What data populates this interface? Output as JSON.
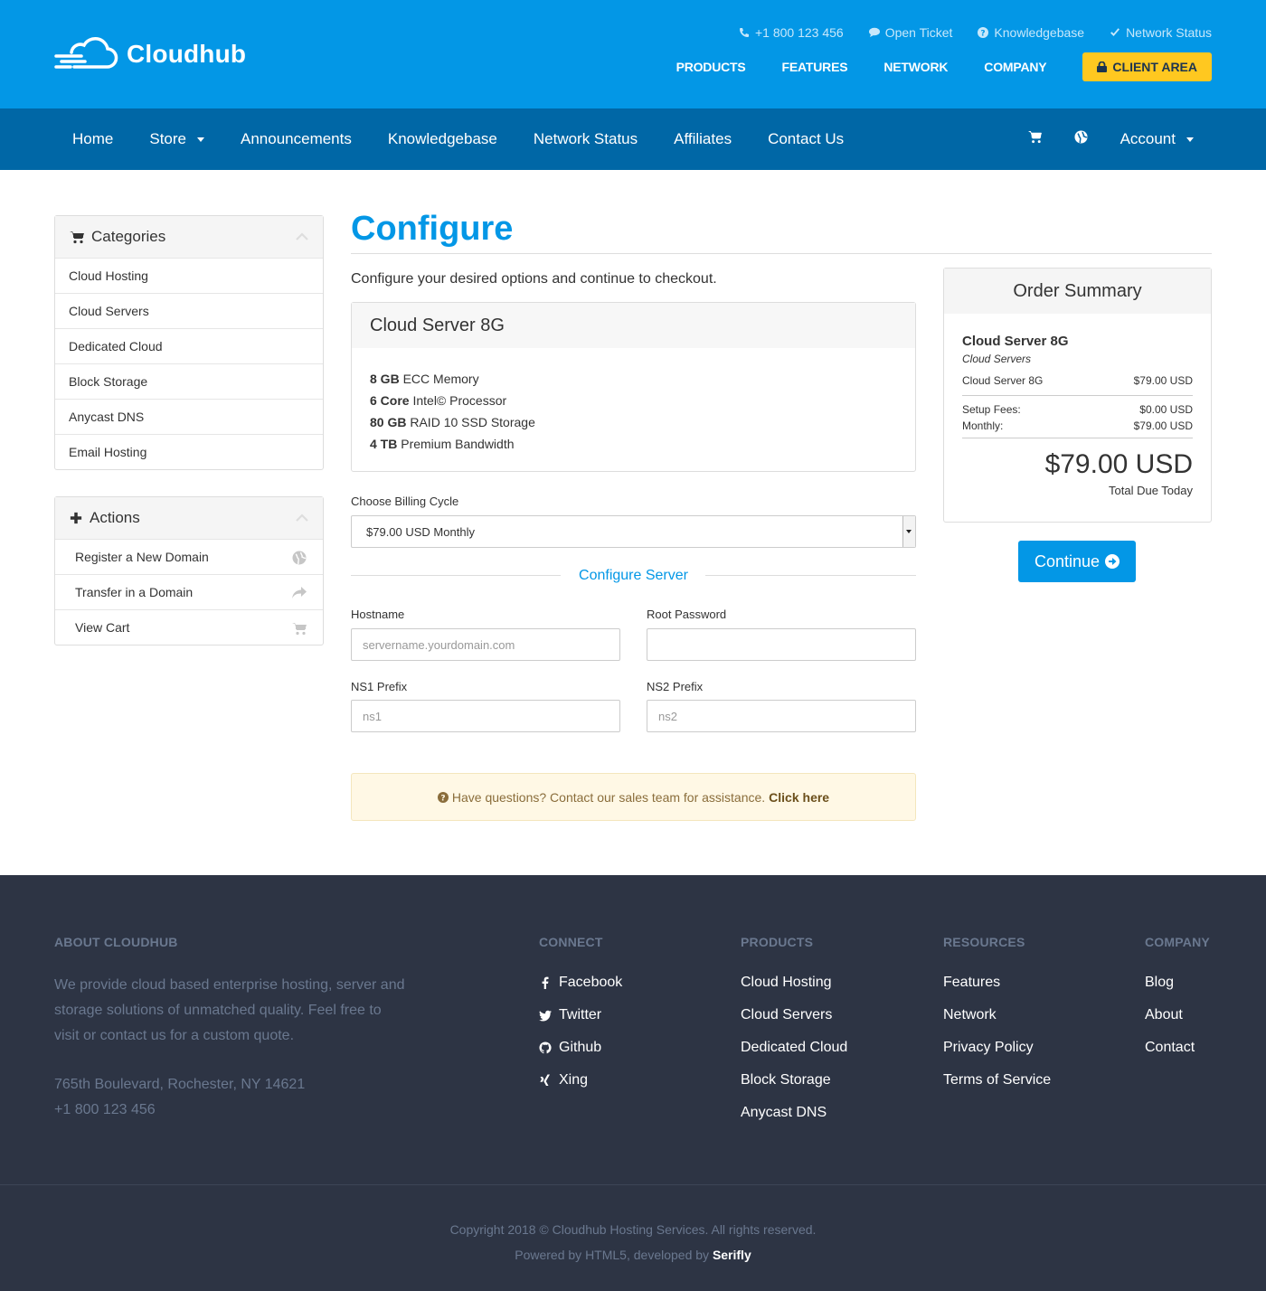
{
  "header": {
    "logo_text": "Cloudhub",
    "utility": [
      {
        "icon": "phone-icon",
        "label": "+1 800 123 456"
      },
      {
        "icon": "chat-icon",
        "label": "Open Ticket"
      },
      {
        "icon": "question-icon",
        "label": "Knowledgebase"
      },
      {
        "icon": "check-icon",
        "label": "Network Status"
      }
    ],
    "nav": [
      "PRODUCTS",
      "FEATURES",
      "NETWORK",
      "COMPANY"
    ],
    "client_area": "CLIENT AREA",
    "colors": {
      "primary": "#0397e6",
      "subnav": "#0067a6",
      "accent": "#ffc820",
      "footer": "#2d3444"
    }
  },
  "subnav": {
    "items": [
      "Home",
      "Store",
      "Announcements",
      "Knowledgebase",
      "Network Status",
      "Affiliates",
      "Contact Us"
    ],
    "account": "Account"
  },
  "sidebar": {
    "categories": {
      "title": "Categories",
      "items": [
        "Cloud Hosting",
        "Cloud Servers",
        "Dedicated Cloud",
        "Block Storage",
        "Anycast DNS",
        "Email Hosting"
      ]
    },
    "actions": {
      "title": "Actions",
      "items": [
        {
          "label": "Register a New Domain",
          "icon": "globe-icon"
        },
        {
          "label": "Transfer in a Domain",
          "icon": "share-icon"
        },
        {
          "label": "View Cart",
          "icon": "cart-icon"
        }
      ]
    }
  },
  "main": {
    "title": "Configure",
    "intro": "Configure your desired options and continue to checkout.",
    "product": {
      "name": "Cloud Server 8G",
      "features": [
        {
          "bold": "8 GB",
          "text": " ECC Memory"
        },
        {
          "bold": "6 Core",
          "text": " Intel© Processor"
        },
        {
          "bold": "80 GB",
          "text": " RAID 10 SSD Storage"
        },
        {
          "bold": "4 TB",
          "text": " Premium Bandwidth"
        }
      ]
    },
    "billing_label": "Choose Billing Cycle",
    "billing_value": "$79.00 USD Monthly",
    "configure_server": "Configure Server",
    "fields": {
      "hostname_label": "Hostname",
      "hostname_placeholder": "servername.yourdomain.com",
      "root_label": "Root Password",
      "ns1_label": "NS1 Prefix",
      "ns1_placeholder": "ns1",
      "ns2_label": "NS2 Prefix",
      "ns2_placeholder": "ns2"
    },
    "alert_text": "Have questions? Contact our sales team for assistance.",
    "alert_link": "Click here"
  },
  "summary": {
    "title": "Order Summary",
    "product_name": "Cloud Server 8G",
    "product_group": "Cloud Servers",
    "line_label": "Cloud Server 8G",
    "line_price": "$79.00 USD",
    "setup_label": "Setup Fees:",
    "setup_value": "$0.00 USD",
    "monthly_label": "Monthly:",
    "monthly_value": "$79.00 USD",
    "total": "$79.00 USD",
    "total_label": "Total Due Today",
    "continue": "Continue"
  },
  "footer": {
    "about_title": "ABOUT CLOUDHUB",
    "about_text": "We provide cloud based enterprise hosting, server and storage solutions of unmatched quality. Feel free to visit or contact us for a custom quote.",
    "address": "765th Boulevard, Rochester, NY 14621",
    "phone": "+1 800 123 456",
    "connect_title": "CONNECT",
    "connect": [
      {
        "label": "Facebook",
        "icon": "facebook-icon"
      },
      {
        "label": "Twitter",
        "icon": "twitter-icon"
      },
      {
        "label": "Github",
        "icon": "github-icon"
      },
      {
        "label": "Xing",
        "icon": "xing-icon"
      }
    ],
    "products_title": "PRODUCTS",
    "products": [
      "Cloud Hosting",
      "Cloud Servers",
      "Dedicated Cloud",
      "Block Storage",
      "Anycast DNS"
    ],
    "resources_title": "RESOURCES",
    "resources": [
      "Features",
      "Network",
      "Privacy Policy",
      "Terms of Service"
    ],
    "company_title": "COMPANY",
    "company": [
      "Blog",
      "About",
      "Contact"
    ],
    "copyright": "Copyright 2018 © Cloudhub Hosting Services. All rights reserved.",
    "powered": "Powered by HTML5, developed by",
    "developer": "Serifly"
  }
}
